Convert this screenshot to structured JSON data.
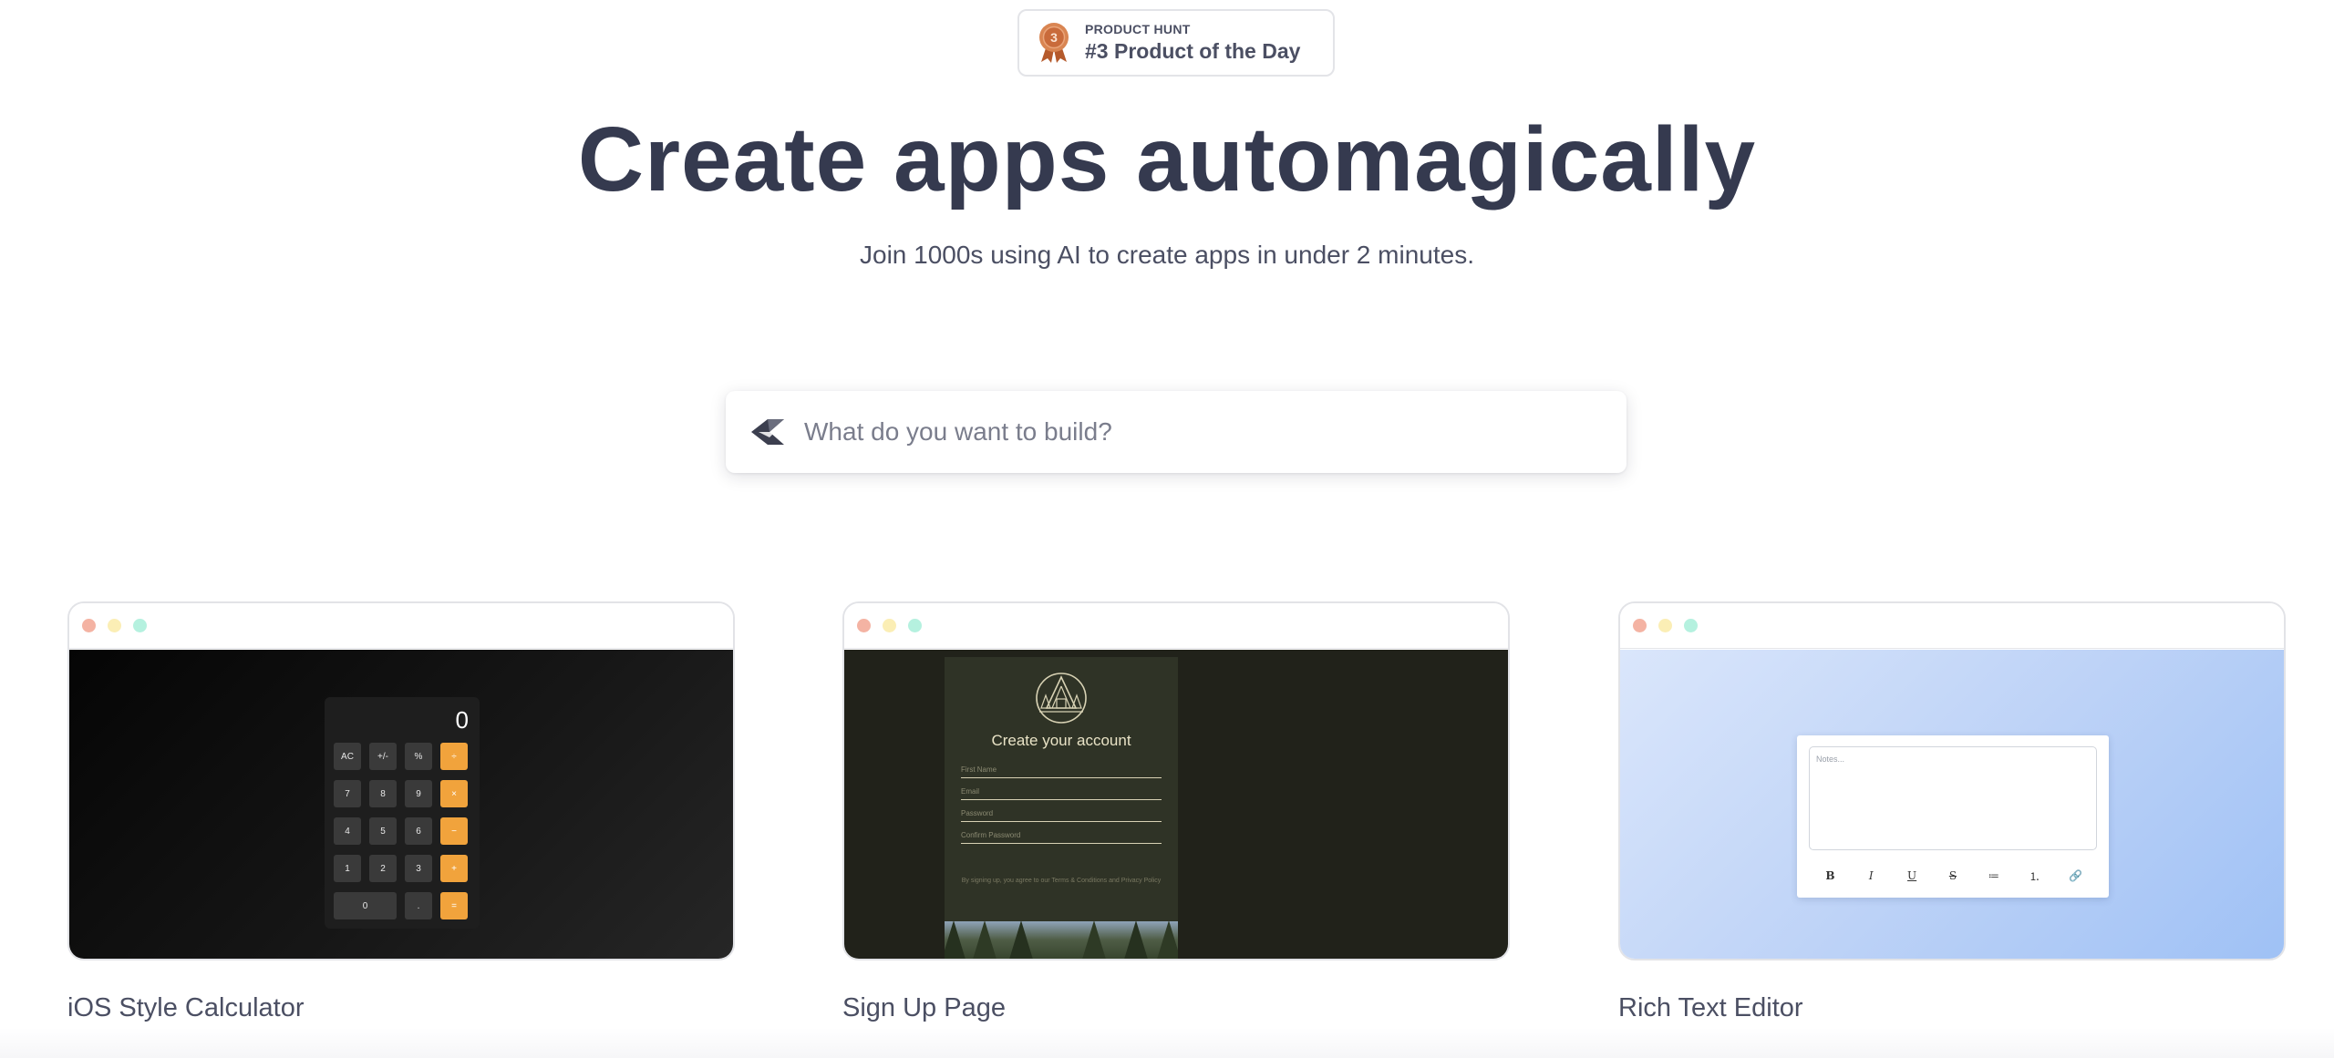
{
  "badge": {
    "small": "PRODUCT HUNT",
    "title": "#3 Product of the Day",
    "medal_number": "3",
    "medal_color": "#c96b3b"
  },
  "hero": {
    "title": "Create apps automagically",
    "subtitle": "Join 1000s using AI to create apps in under 2 minutes."
  },
  "search": {
    "placeholder": "What do you want to build?",
    "icon": "send-arrow-icon"
  },
  "cards": [
    {
      "label": "iOS Style Calculator",
      "preview": {
        "display": "0",
        "keys": [
          "AC",
          "+/-",
          "%",
          "÷",
          "7",
          "8",
          "9",
          "×",
          "4",
          "5",
          "6",
          "−",
          "1",
          "2",
          "3",
          "+",
          "0",
          ".",
          "="
        ]
      }
    },
    {
      "label": "Sign Up Page",
      "preview": {
        "title": "Create your account",
        "fields": [
          "First Name",
          "Email",
          "Password",
          "Confirm Password"
        ],
        "terms": "By signing up, you agree to our Terms & Conditions and Privacy Policy"
      }
    },
    {
      "label": "Rich Text Editor",
      "preview": {
        "placeholder": "Notes...",
        "tools": [
          "B",
          "I",
          "U",
          "S",
          "≔",
          "⒈",
          "🔗"
        ]
      }
    }
  ],
  "colors": {
    "heading": "#353a4f",
    "accent_orange": "#f1a33c",
    "window_dot_red": "#f4b3a3",
    "window_dot_yellow": "#fbeeb5",
    "window_dot_green": "#b5f1df"
  }
}
